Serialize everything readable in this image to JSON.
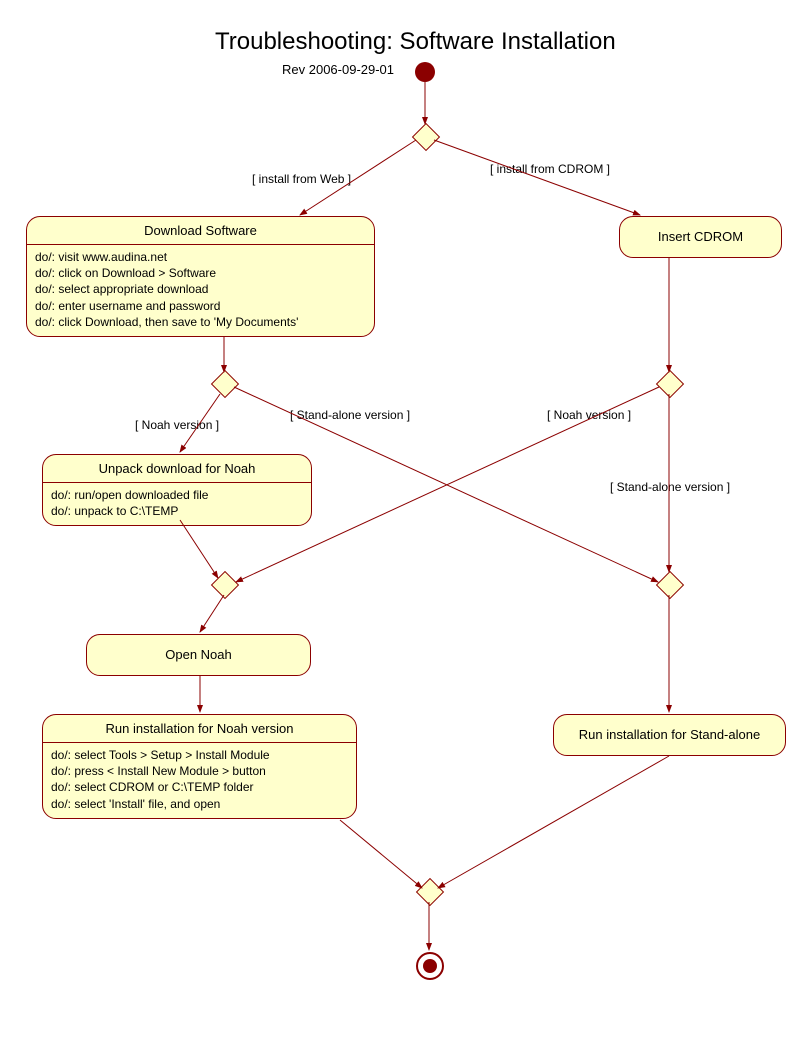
{
  "title": "Troubleshooting: Software Installation",
  "rev": "Rev 2006-09-29-01",
  "guards": {
    "install_web": "[ install from Web ]",
    "install_cdrom": "[ install from CDROM ]",
    "noah_left": "[ Noah version ]",
    "standalone_left": "[ Stand-alone version ]",
    "noah_right": "[ Noah version ]",
    "standalone_right": "[ Stand-alone version ]"
  },
  "activities": {
    "download": {
      "title": "Download Software",
      "lines": [
        "do/: visit www.audina.net",
        "do/: click on Download > Software",
        "do/: select appropriate download",
        "do/: enter username and password",
        "do/: click Download, then save to 'My Documents'"
      ]
    },
    "insert_cdrom": {
      "title": "Insert CDROM"
    },
    "unpack": {
      "title": "Unpack download for Noah",
      "lines": [
        "do/: run/open downloaded file",
        "do/: unpack to C:\\TEMP"
      ]
    },
    "open_noah": {
      "title": "Open Noah"
    },
    "run_noah": {
      "title": "Run installation for Noah version",
      "lines": [
        "do/: select Tools > Setup > Install Module",
        "do/: press < Install New Module > button",
        "do/: select CDROM or C:\\TEMP folder",
        "do/: select 'Install' file, and open"
      ]
    },
    "run_standalone": {
      "title": "Run installation for Stand-alone"
    }
  }
}
